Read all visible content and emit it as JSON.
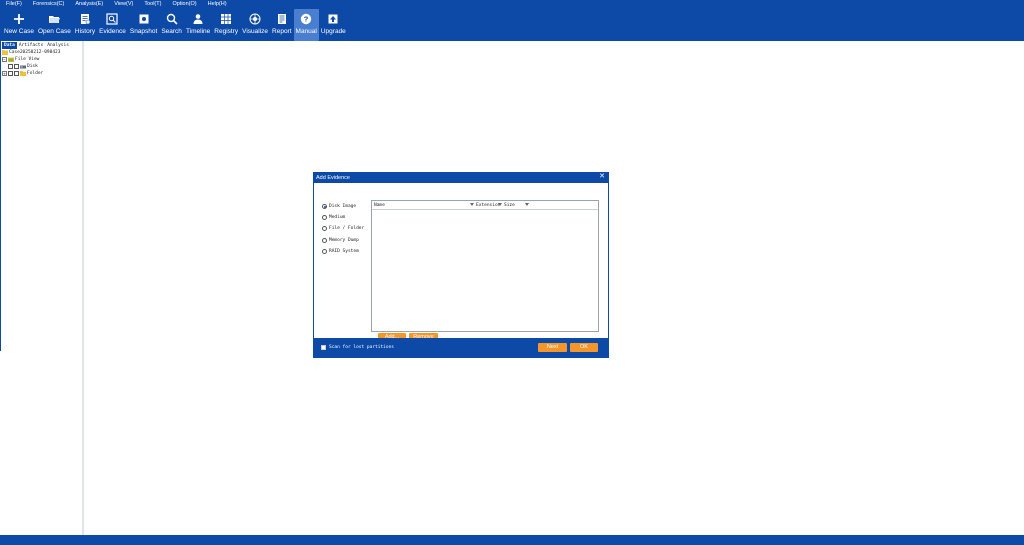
{
  "menu": [
    "File(F)",
    "Forensics(C)",
    "Analysis(E)",
    "View(V)",
    "Tool(T)",
    "Option(O)",
    "Help(H)"
  ],
  "toolbar": [
    {
      "label": "New Case",
      "icon": "plus-icon"
    },
    {
      "label": "Open Case",
      "icon": "folder-open-icon"
    },
    {
      "label": "History",
      "icon": "history-icon"
    },
    {
      "label": "Evidence",
      "icon": "evidence-icon"
    },
    {
      "label": "Snapshot",
      "icon": "snapshot-icon"
    },
    {
      "label": "Search",
      "icon": "search-icon"
    },
    {
      "label": "Timeline",
      "icon": "timeline-icon"
    },
    {
      "label": "Registry",
      "icon": "registry-icon"
    },
    {
      "label": "Visualize",
      "icon": "visualize-icon"
    },
    {
      "label": "Report",
      "icon": "report-icon"
    },
    {
      "label": "Manual",
      "icon": "help-circle-icon",
      "active": true
    },
    {
      "label": "Upgrade",
      "icon": "upgrade-icon"
    }
  ],
  "left_panel": {
    "tabs": [
      "Data",
      "Artifacts",
      "Analysis"
    ],
    "active_tab": "Data",
    "tree": {
      "case": "Case20250212-090423",
      "file_view": "File View",
      "disk": "Disk",
      "folder": "Folder"
    }
  },
  "dialog": {
    "title": "Add Evidence",
    "close": "✕",
    "options": [
      "Disk Image",
      "Medium",
      "File / Folder",
      "Memory Dump",
      "RAID System"
    ],
    "selected_option": "Disk Image",
    "columns": [
      "Name",
      "Extension",
      "Size"
    ],
    "add_button": "Add...",
    "remove_button": "Remove",
    "scan_label": "Scan for lost partitions",
    "next_button": "Next",
    "ok_button": "OK"
  },
  "colors": {
    "primary": "#0d4aa8",
    "accent": "#f5962a",
    "active_tool": "#4a7fcf"
  }
}
